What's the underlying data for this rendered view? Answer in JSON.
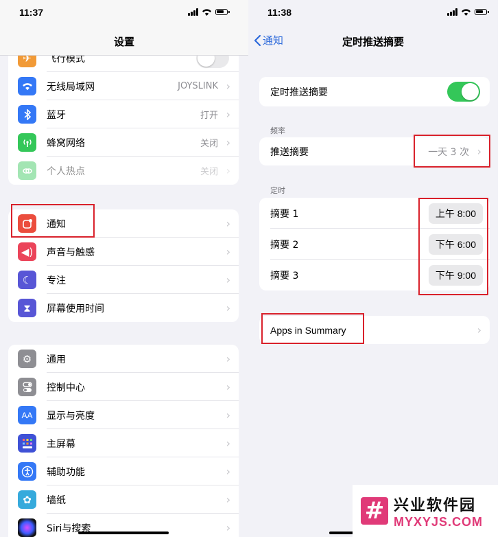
{
  "left": {
    "time": "11:37",
    "title": "设置",
    "group1": [
      {
        "label": "飞行模式",
        "icon": "airplane-icon",
        "color": "#f19a37"
      },
      {
        "label": "无线局域网",
        "value": "JOYSLINK",
        "icon": "wifi-icon",
        "color": "#3478f6"
      },
      {
        "label": "蓝牙",
        "value": "打开",
        "icon": "bluetooth-icon",
        "color": "#3478f6"
      },
      {
        "label": "蜂窝网络",
        "value": "关闭",
        "icon": "cellular-icon",
        "color": "#34c759"
      },
      {
        "label": "个人热点",
        "value": "关闭",
        "icon": "hotspot-icon",
        "color": "#34c759"
      }
    ],
    "group2": [
      {
        "label": "通知",
        "icon": "notification-icon",
        "color": "#eb4d3d"
      },
      {
        "label": "声音与触感",
        "icon": "speaker-icon",
        "color": "#eb445a"
      },
      {
        "label": "专注",
        "icon": "moon-icon",
        "color": "#5856d6"
      },
      {
        "label": "屏幕使用时间",
        "icon": "hourglass-icon",
        "color": "#5856d6"
      }
    ],
    "group3": [
      {
        "label": "通用",
        "icon": "gear-icon",
        "color": "#8e8e93"
      },
      {
        "label": "控制中心",
        "icon": "switches-icon",
        "color": "#8e8e93"
      },
      {
        "label": "显示与亮度",
        "icon": "aa-icon",
        "color": "#3478f6"
      },
      {
        "label": "主屏幕",
        "icon": "home-screen-icon",
        "color": "#3f51d6"
      },
      {
        "label": "辅助功能",
        "icon": "accessibility-icon",
        "color": "#3478f6"
      },
      {
        "label": "墙纸",
        "icon": "flower-icon",
        "color": "#36aadc"
      },
      {
        "label": "Siri与搜索",
        "icon": "siri-icon",
        "color": "#222222"
      }
    ]
  },
  "right": {
    "time": "11:38",
    "back_label": "通知",
    "title": "定时推送摘要",
    "toggle_label": "定时推送摘要",
    "freq_header": "频率",
    "freq_label": "推送摘要",
    "freq_value": "一天 3 次",
    "timing_header": "定时",
    "summaries": [
      {
        "label": "摘要 1",
        "time": "上午 8:00"
      },
      {
        "label": "摘要 2",
        "time": "下午 6:00"
      },
      {
        "label": "摘要 3",
        "time": "下午 9:00"
      }
    ],
    "apps_label": "Apps in Summary"
  },
  "watermark": {
    "logo_char": "#",
    "cn": "兴业软件园",
    "en": "MYXYJS.COM"
  },
  "colors": {
    "accent_blue": "#2f6bdb",
    "toggle_green": "#34c759",
    "highlight_red": "#d9212b",
    "watermark_pink": "#e03a78"
  }
}
